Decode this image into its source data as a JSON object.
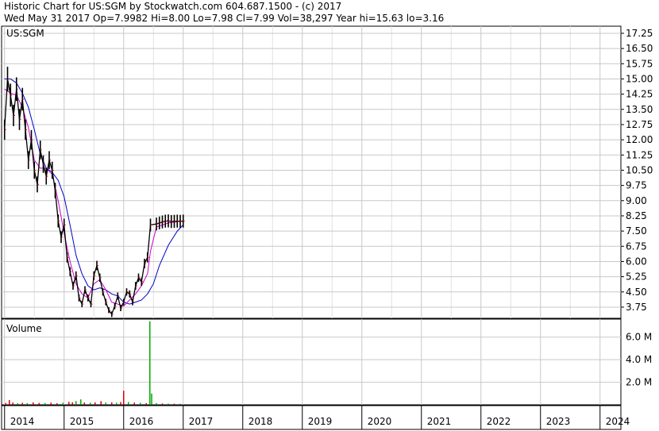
{
  "header": {
    "line1": "Historic Chart for US:SGM by Stockwatch.com 604.687.1500 - (c) 2017",
    "line2": "Wed May 31 2017   Op=7.9982  Hi=8.00  Lo=7.98  Cl=7.99  Vol=38,297  Year hi=15.63  lo=3.16"
  },
  "colors": {
    "price": "#000000",
    "up_tick": "#cc0000",
    "ma_short": "#cc00cc",
    "ma_long": "#0000cc",
    "volume_red": "#dd0000",
    "volume_green": "#00aa00",
    "grid": "#c8c8c8"
  },
  "chart_data": [
    {
      "type": "line",
      "title": "US:SGM",
      "ylim": [
        3.2,
        17.6
      ],
      "y_ticks": [
        "17.25",
        "16.50",
        "15.75",
        "15.00",
        "14.25",
        "13.50",
        "12.75",
        "12.00",
        "11.25",
        "10.50",
        "9.75",
        "9.00",
        "8.25",
        "7.50",
        "6.75",
        "6.00",
        "5.25",
        "4.50",
        "3.75"
      ],
      "x_ticks": [
        "2014",
        "2015",
        "2016",
        "2017",
        "2018",
        "2019",
        "2020",
        "2021",
        "2022",
        "2023",
        "2024"
      ],
      "xlim": [
        2013.95,
        2024.35
      ],
      "series": [
        {
          "x": [
            2014.0,
            2014.05,
            2014.1,
            2014.15,
            2014.2,
            2014.25,
            2014.3,
            2014.35,
            2014.4,
            2014.45,
            2014.5,
            2014.55,
            2014.6,
            2014.65,
            2014.7,
            2014.75,
            2014.8,
            2014.85,
            2014.9,
            2014.95,
            2015.0,
            2015.05,
            2015.1,
            2015.15,
            2015.2,
            2015.25,
            2015.3,
            2015.35,
            2015.4,
            2015.45,
            2015.5,
            2015.55,
            2015.6,
            2015.65,
            2015.7,
            2015.75,
            2015.8,
            2015.85,
            2015.9,
            2015.95,
            2016.0,
            2016.05,
            2016.1,
            2016.15,
            2016.2,
            2016.25,
            2016.3,
            2016.35,
            2016.4,
            2016.45,
            2016.55,
            2016.6,
            2016.65,
            2016.7,
            2016.75,
            2016.8,
            2016.85,
            2016.9,
            2016.95,
            2017.0
          ],
          "values": [
            12.5,
            15.0,
            14.2,
            13.2,
            14.5,
            13.0,
            14.0,
            12.5,
            11.0,
            12.0,
            10.5,
            9.8,
            11.5,
            10.8,
            10.2,
            11.0,
            10.5,
            9.5,
            8.0,
            7.2,
            7.8,
            6.2,
            5.5,
            4.8,
            5.3,
            4.2,
            3.9,
            4.6,
            4.2,
            3.9,
            5.3,
            5.8,
            5.2,
            4.5,
            4.0,
            3.6,
            3.4,
            3.8,
            4.3,
            3.7,
            4.0,
            4.5,
            4.4,
            4.0,
            4.8,
            5.2,
            5.0,
            5.9,
            6.2,
            7.8,
            7.85,
            7.9,
            7.95,
            7.99,
            8.0,
            7.97,
            7.98,
            7.99,
            7.98,
            7.99
          ]
        },
        {
          "name": "",
          "x": [
            2014.0,
            2014.1,
            2014.2,
            2014.3,
            2014.4,
            2014.5,
            2014.6,
            2014.7,
            2014.8,
            2014.9,
            2015.0,
            2015.1,
            2015.2,
            2015.3,
            2015.4,
            2015.5,
            2015.6,
            2015.7,
            2015.8,
            2015.9,
            2016.0,
            2016.1,
            2016.2,
            2016.3,
            2016.4,
            2016.45,
            2016.55,
            2016.75,
            2017.0
          ],
          "values": [
            14.5,
            14.3,
            14.2,
            13.6,
            12.6,
            11.0,
            10.6,
            10.6,
            10.3,
            9.0,
            7.4,
            6.0,
            4.9,
            4.4,
            4.2,
            4.9,
            5.1,
            4.6,
            4.0,
            3.9,
            3.8,
            4.1,
            4.4,
            4.8,
            5.4,
            6.5,
            7.7,
            7.9,
            8.0
          ]
        },
        {
          "name": "",
          "x": [
            2014.0,
            2014.1,
            2014.2,
            2014.3,
            2014.4,
            2014.5,
            2014.6,
            2014.7,
            2014.8,
            2014.9,
            2015.0,
            2015.1,
            2015.2,
            2015.3,
            2015.4,
            2015.5,
            2015.6,
            2015.7,
            2015.8,
            2015.9,
            2016.0,
            2016.1,
            2016.2,
            2016.3,
            2016.4,
            2016.5,
            2016.6,
            2016.75,
            2016.9,
            2017.0
          ],
          "values": [
            15.0,
            15.0,
            14.8,
            14.3,
            13.6,
            12.5,
            11.3,
            10.6,
            10.4,
            10.0,
            9.2,
            7.8,
            6.3,
            5.4,
            4.8,
            4.6,
            4.7,
            4.6,
            4.4,
            4.3,
            4.0,
            3.9,
            4.0,
            4.1,
            4.4,
            4.9,
            5.8,
            6.8,
            7.5,
            7.8
          ]
        }
      ]
    },
    {
      "type": "bar",
      "title": "Volume",
      "ylim": [
        0,
        7600000
      ],
      "y_ticks": [
        "6.0 M",
        "4.0 M",
        "2.0 M"
      ],
      "y_tick_values": [
        6000000,
        4000000,
        2000000
      ],
      "bars": [
        {
          "x": 2014.02,
          "value": 160000,
          "color": "red"
        },
        {
          "x": 2014.08,
          "value": 420000,
          "color": "red"
        },
        {
          "x": 2014.14,
          "value": 200000,
          "color": "red"
        },
        {
          "x": 2014.22,
          "value": 140000,
          "color": "green"
        },
        {
          "x": 2014.3,
          "value": 180000,
          "color": "red"
        },
        {
          "x": 2014.38,
          "value": 150000,
          "color": "green"
        },
        {
          "x": 2014.48,
          "value": 220000,
          "color": "red"
        },
        {
          "x": 2014.58,
          "value": 170000,
          "color": "red"
        },
        {
          "x": 2014.68,
          "value": 160000,
          "color": "green"
        },
        {
          "x": 2014.78,
          "value": 190000,
          "color": "red"
        },
        {
          "x": 2014.88,
          "value": 140000,
          "color": "red"
        },
        {
          "x": 2014.98,
          "value": 180000,
          "color": "green"
        },
        {
          "x": 2015.08,
          "value": 260000,
          "color": "red"
        },
        {
          "x": 2015.14,
          "value": 220000,
          "color": "red"
        },
        {
          "x": 2015.2,
          "value": 330000,
          "color": "green"
        },
        {
          "x": 2015.28,
          "value": 480000,
          "color": "green"
        },
        {
          "x": 2015.34,
          "value": 200000,
          "color": "red"
        },
        {
          "x": 2015.44,
          "value": 180000,
          "color": "green"
        },
        {
          "x": 2015.52,
          "value": 220000,
          "color": "red"
        },
        {
          "x": 2015.62,
          "value": 330000,
          "color": "red"
        },
        {
          "x": 2015.7,
          "value": 200000,
          "color": "green"
        },
        {
          "x": 2015.8,
          "value": 220000,
          "color": "red"
        },
        {
          "x": 2015.88,
          "value": 180000,
          "color": "green"
        },
        {
          "x": 2015.95,
          "value": 240000,
          "color": "red"
        },
        {
          "x": 2016.0,
          "value": 1250000,
          "color": "red"
        },
        {
          "x": 2016.08,
          "value": 250000,
          "color": "green"
        },
        {
          "x": 2016.18,
          "value": 200000,
          "color": "red"
        },
        {
          "x": 2016.28,
          "value": 180000,
          "color": "green"
        },
        {
          "x": 2016.38,
          "value": 150000,
          "color": "red"
        },
        {
          "x": 2016.44,
          "value": 7400000,
          "color": "green"
        },
        {
          "x": 2016.47,
          "value": 1000000,
          "color": "green"
        },
        {
          "x": 2016.55,
          "value": 150000,
          "color": "green"
        },
        {
          "x": 2016.65,
          "value": 120000,
          "color": "red"
        },
        {
          "x": 2016.75,
          "value": 110000,
          "color": "green"
        },
        {
          "x": 2016.85,
          "value": 100000,
          "color": "red"
        },
        {
          "x": 2016.95,
          "value": 90000,
          "color": "green"
        }
      ]
    }
  ]
}
